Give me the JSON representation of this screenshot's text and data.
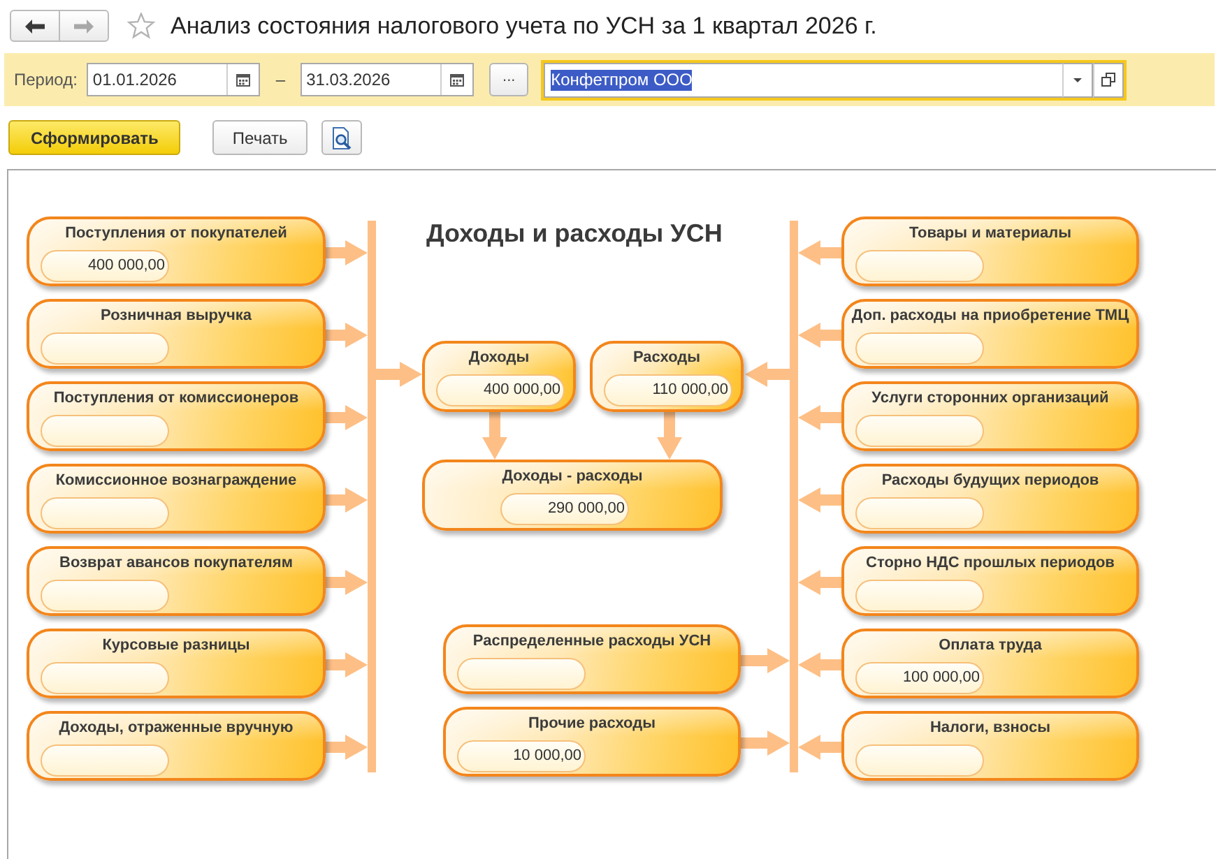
{
  "nav_buttons": [
    {
      "kind": "back",
      "disabled": false
    },
    {
      "kind": "forward",
      "disabled": true
    }
  ],
  "window": {
    "title": "Анализ состояния налогового учета по УСН за 1 квартал 2026 г.",
    "favorite": false
  },
  "filters": {
    "period_label": "Период:",
    "date_from": "01.01.2026",
    "range_dash": "–",
    "date_to": "31.03.2026",
    "period_button": "...",
    "organization": {
      "value": "Конфетпром ООО",
      "focused": true,
      "text_highlighted": true
    }
  },
  "actions": [
    {
      "kind": "text",
      "label": "Сформировать",
      "default": true
    },
    {
      "kind": "text",
      "label": "Печать",
      "default": false
    },
    {
      "kind": "icon"
    }
  ],
  "report": {
    "title": "Доходы и расходы УСН",
    "income_items": [
      {
        "label": "Поступления от покупателей",
        "value": "400 000,00"
      },
      {
        "label": "Розничная выручка"
      },
      {
        "label": "Поступления от комиссионеров"
      },
      {
        "label": "Комиссионное вознаграждение"
      },
      {
        "label": "Возврат авансов покупателям"
      },
      {
        "label": "Курсовые разницы"
      },
      {
        "label": "Доходы, отраженные вручную"
      }
    ],
    "totals": [
      {
        "label": "Доходы",
        "value": "400 000,00"
      },
      {
        "label": "Расходы",
        "value": "110 000,00"
      }
    ],
    "result": {
      "label": "Доходы - расходы",
      "value": "290 000,00"
    },
    "other_expenses": [
      {
        "label": "Распределенные расходы УСН"
      },
      {
        "label": "Прочие расходы",
        "value": "10 000,00"
      }
    ],
    "expense_items": [
      {
        "label": "Товары и материалы"
      },
      {
        "label": "Доп. расходы на приобретение ТМЦ"
      },
      {
        "label": "Услуги сторонних организаций"
      },
      {
        "label": "Расходы будущих периодов"
      },
      {
        "label": "Сторно НДС прошлых периодов"
      },
      {
        "label": "Оплата труда",
        "value": "100 000,00"
      },
      {
        "label": "Налоги, взносы"
      }
    ]
  }
}
